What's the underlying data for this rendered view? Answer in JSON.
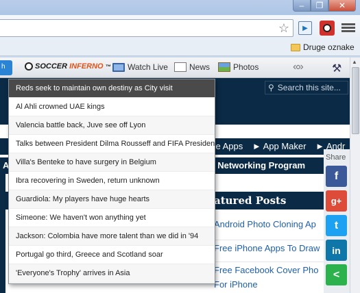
{
  "window": {
    "minimize_icon": "minimize-icon",
    "restore_icon": "restore-icon",
    "close_icon": "close-icon"
  },
  "bookmarks": {
    "other_label": "Druge oznake"
  },
  "toolbar": {
    "logo_text_a": "SOCCER",
    "logo_text_b": "INFERNO",
    "logo_tm": "™",
    "watch_live": "Watch Live",
    "news": "News",
    "photos": "Photos"
  },
  "site": {
    "search_placeholder": "Search this site...",
    "nav1": [
      "one Apps",
      "► App Maker",
      "► Andr"
    ],
    "nav2_left": "A",
    "nav2": "l Networking   Program",
    "featured_title": "atured Posts",
    "posts": [
      "Android Photo Cloning Ap",
      "Free iPhone Apps To Draw",
      "Free Facebook Cover Pho",
      "For iPhone"
    ]
  },
  "share": {
    "label": "Share",
    "buttons": [
      {
        "name": "facebook",
        "glyph": "f",
        "color": "#3b5998"
      },
      {
        "name": "google-plus",
        "glyph": "g+",
        "color": "#dd4b39"
      },
      {
        "name": "twitter",
        "glyph": "t",
        "color": "#1da1f2"
      },
      {
        "name": "linkedin",
        "glyph": "in",
        "color": "#0e76a8"
      },
      {
        "name": "share",
        "glyph": "<",
        "color": "#2bb24c"
      }
    ]
  },
  "dropdown": {
    "items": [
      "Reds seek to maintain own destiny as City visit",
      "Al Ahli crowned UAE kings",
      "Valencia battle back, Juve see off Lyon",
      "Talks between President Dilma Rousseff and FIFA President",
      "Villa's Benteke to have surgery in Belgium",
      "Ibra recovering in Sweden, return unknown",
      "Guardiola: My players have huge hearts",
      "Simeone: We haven't won anything yet",
      "Jackson: Colombia have more talent than we did in '94",
      "Portugal go third, Greece and Scotland soar",
      "'Everyone's Trophy' arrives in Asia"
    ]
  }
}
